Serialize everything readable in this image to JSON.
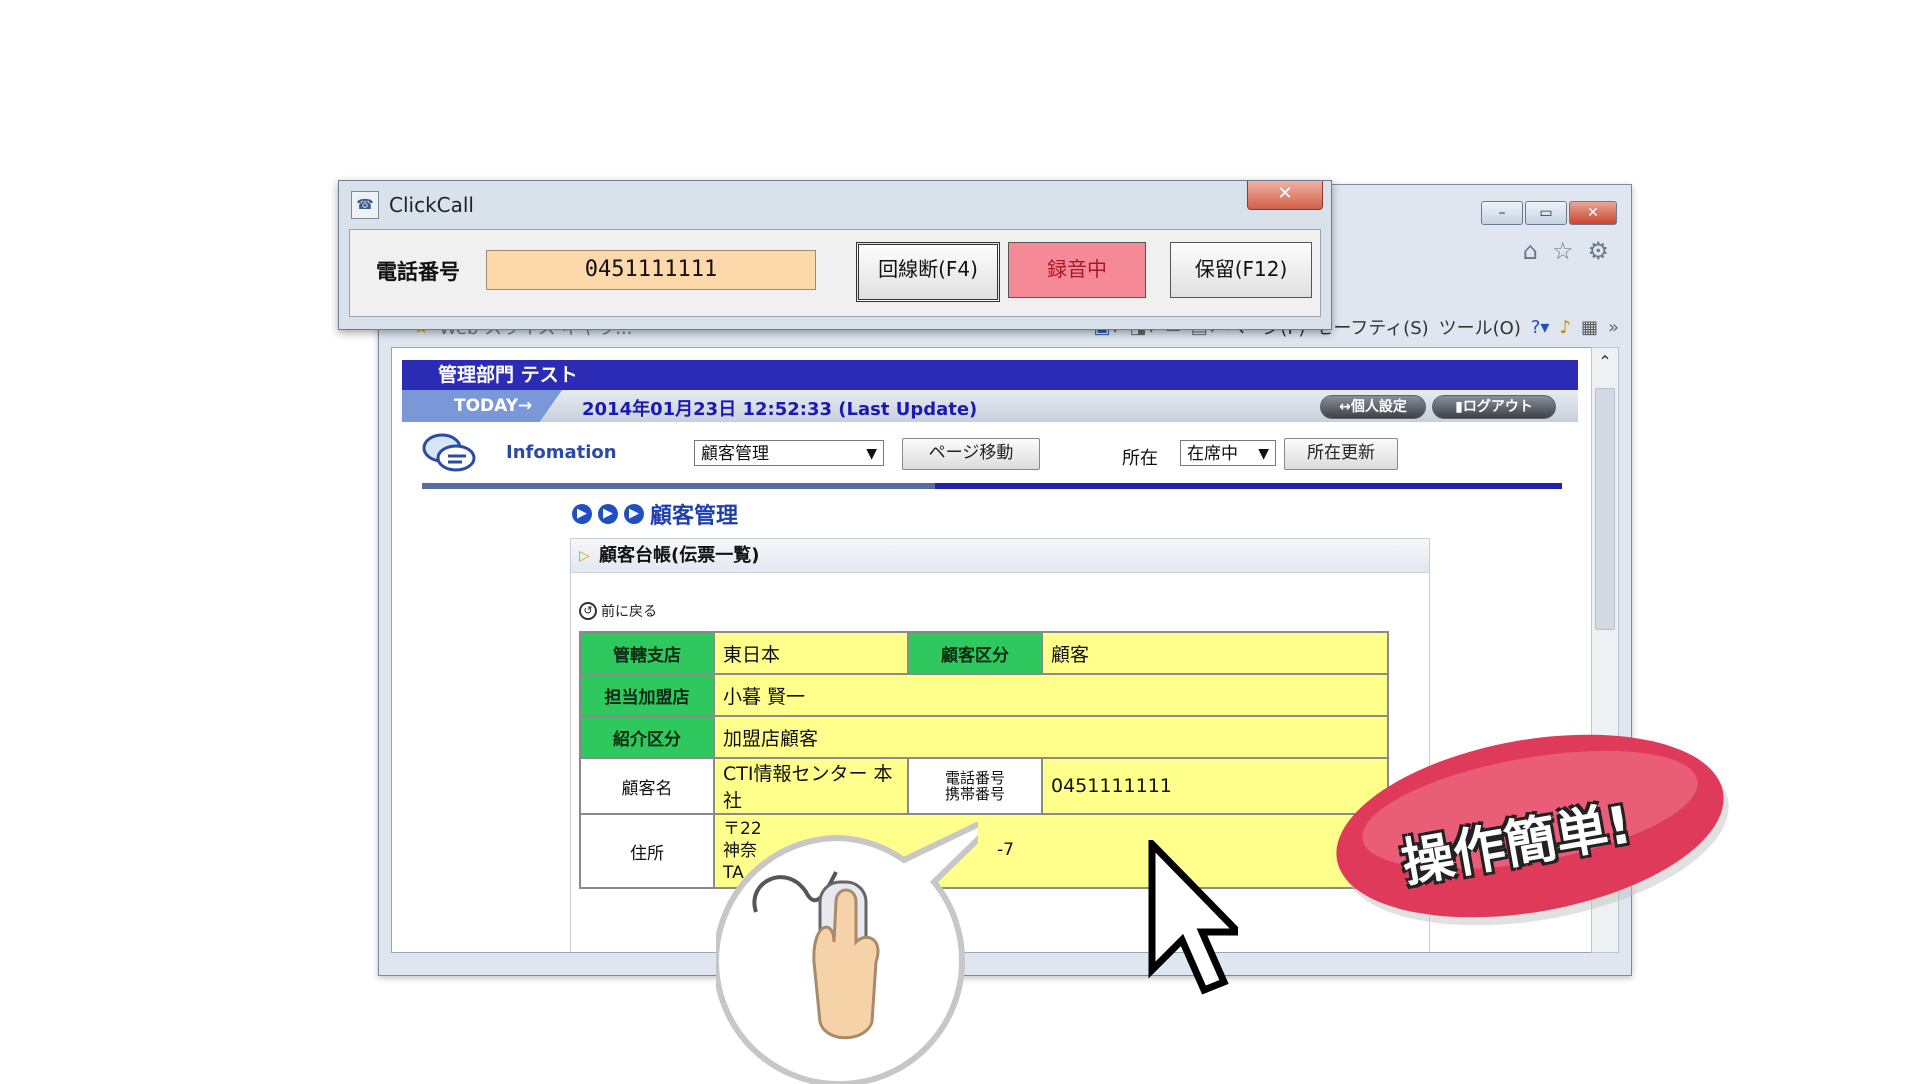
{
  "browser": {
    "window_controls": [
      "–",
      "▭",
      "✕"
    ],
    "nav_icons": [
      "home-icon",
      "star-icon",
      "gear-icon"
    ],
    "cmdbar": {
      "items": [
        "Web スライス ギャラ...",
        "ページ(P)",
        "セーフティ(S)",
        "ツール(O)"
      ],
      "more": "»"
    }
  },
  "page": {
    "dept_title": "管理部門 テスト",
    "today_label": "TODAY→",
    "last_update": "2014年01月23日 12:52:33 (Last Update)",
    "personal_settings": "↔個人設定",
    "logout": "ログアウト",
    "info_label": "Infomation",
    "page_select": "顧客管理",
    "page_move_button": "ページ移動",
    "location_label": "所在",
    "location_select": "在席中",
    "location_update_button": "所在更新",
    "section_title": "顧客管理",
    "panel_title": "顧客台帳(伝票一覧)",
    "back_link": "前に戻る",
    "table": {
      "branch_label": "管轄支店",
      "branch_value": "東日本",
      "category_label": "顧客区分",
      "category_value": "顧客",
      "agent_label": "担当加盟店",
      "agent_value": "小暮 賢一",
      "referral_label": "紹介区分",
      "referral_value": "加盟店顧客",
      "name_label": "顧客名",
      "name_value": "CTI情報センター 本社",
      "phone_label": "電話番号\n携帯番号",
      "phone_value": "0451111111",
      "address_label": "住所",
      "address_value": "〒22\n神奈\nTA",
      "address_tail": "-7"
    }
  },
  "dialog": {
    "title": "ClickCall",
    "close": "✕",
    "tel_label": "電話番号",
    "tel_value": "0451111111",
    "hangup_button": "回線断(F4)",
    "recording_button": "録音中",
    "hold_button": "保留(F12)"
  },
  "overlay": {
    "badge_text": "操作簡単!"
  },
  "colors": {
    "dept_bar": "#2b2bb5",
    "label_green": "#2ec85f",
    "value_yellow": "#ffff8c",
    "tel_input": "#fcd8ab",
    "recording": "#f58a96",
    "badge": "#e03a5a"
  }
}
